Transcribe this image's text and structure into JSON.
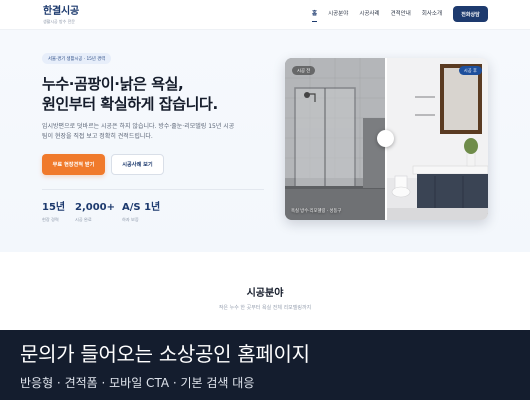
{
  "header": {
    "logo": "한결시공",
    "logo_sub": "생활시공 방수 전문",
    "nav": [
      "홈",
      "시공분야",
      "시공사례",
      "견적안내",
      "회사소개"
    ],
    "cta": "전화상담"
  },
  "hero": {
    "badge": "서울·경기 생활시공 · 15년 경력",
    "title_line1": "누수·곰팡이·낡은 욕실,",
    "title_line2": "원인부터 확실하게 잡습니다.",
    "desc_line1": "임시방편으로 덧바르는 시공은 하지 않습니다. 방수·줄눈·리모델링 15년 시공",
    "desc_line2": "팀이 현장을 직접 보고 정확히 견적드립니다.",
    "primary_button": "무료 현장견적 받기",
    "secondary_button": "시공사례 보기",
    "stats": [
      {
        "value": "15년",
        "label": "현장 경력"
      },
      {
        "value": "2,000+",
        "label": "시공 완료"
      },
      {
        "value": "A/S 1년",
        "label": "하자 보증"
      }
    ],
    "compare": {
      "before_tag": "시공 전",
      "after_tag": "시공 후",
      "caption": "욕실 방수·리모델링 · 성동구"
    }
  },
  "section": {
    "title": "시공분야",
    "subtitle": "작은 누수 한 곳부터 욕실 전체 리모델링까지"
  },
  "banner": {
    "title": "문의가 들어오는 소상공인 홈페이지",
    "subtitle": "반응형 · 견적폼 · 모바일 CTA · 기본 검색 대응"
  },
  "colors": {
    "brand": "#1d3a6e",
    "accent": "#f07a2c",
    "banner_bg": "#141d2e"
  }
}
